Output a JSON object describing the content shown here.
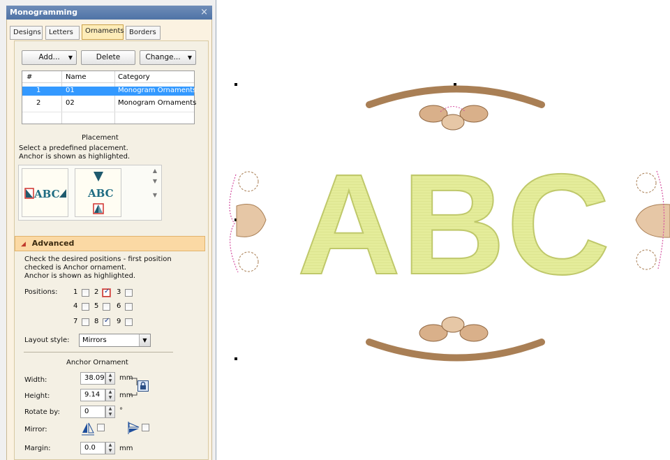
{
  "window": {
    "title": "Monogramming",
    "close_glyph": "×"
  },
  "tabs": [
    {
      "label": "Designs",
      "active": false
    },
    {
      "label": "Letters",
      "active": false
    },
    {
      "label": "Ornaments",
      "active": true
    },
    {
      "label": "Borders",
      "active": false
    }
  ],
  "toolbar": {
    "add_label": "Add...",
    "delete_label": "Delete",
    "change_label": "Change..."
  },
  "ornament_list": {
    "columns": [
      "#",
      "Name",
      "Category"
    ],
    "rows": [
      {
        "num": "1",
        "name": "01",
        "category": "Monogram Ornaments",
        "selected": true
      },
      {
        "num": "2",
        "name": "02",
        "category": "Monogram Ornaments",
        "selected": false
      }
    ]
  },
  "placement": {
    "heading": "Placement",
    "instruction_line1": "Select a predefined placement.",
    "instruction_line2": "Anchor is shown as highlighted.",
    "thumb1_text": "ABC",
    "thumb2_text": "ABC"
  },
  "advanced": {
    "heading": "Advanced",
    "desc_line1": "Check the desired positions - first position",
    "desc_line2": "checked is Anchor ornament.",
    "desc_line3": "Anchor is shown as highlighted.",
    "positions_label": "Positions:",
    "positions": [
      {
        "n": "1",
        "checked": false
      },
      {
        "n": "2",
        "checked": true,
        "anchor": true
      },
      {
        "n": "3",
        "checked": false
      },
      {
        "n": "4",
        "checked": false
      },
      {
        "n": "5",
        "checked": false
      },
      {
        "n": "6",
        "checked": false
      },
      {
        "n": "7",
        "checked": false
      },
      {
        "n": "8",
        "checked": true,
        "anchor": false
      },
      {
        "n": "9",
        "checked": false
      }
    ],
    "layout_label": "Layout style:",
    "layout_value": "Mirrors",
    "anchor_heading": "Anchor Ornament",
    "width_label": "Width:",
    "width_value": "38.09",
    "height_label": "Height:",
    "height_value": "9.14",
    "unit_mm": "mm",
    "rotate_label": "Rotate by:",
    "rotate_value": "0",
    "rotate_unit": "°",
    "mirror_label": "Mirror:",
    "margin_label": "Margin:",
    "margin_value": "0.0"
  },
  "canvas": {
    "monogram_text": "ABC",
    "colors": {
      "letters": "#e4ec9a",
      "letters_stroke": "#bfc86a",
      "ornament_brown": "#a97f55",
      "ornament_peach": "#e6c7a6",
      "outline_pink": "#d44fa0"
    }
  }
}
